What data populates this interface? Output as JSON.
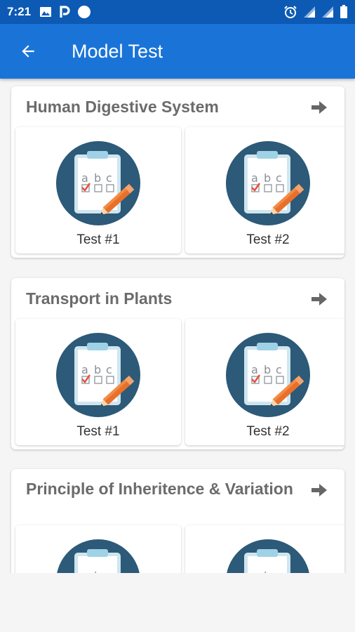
{
  "status_bar": {
    "time": "7:21",
    "left_icons": [
      "image-icon",
      "p-app-icon",
      "circle-app-icon"
    ],
    "right_icons": [
      "alarm-icon",
      "signal-icon",
      "signal-icon",
      "battery-icon"
    ]
  },
  "app_bar": {
    "title": "Model Test",
    "back_icon": "arrow-back-icon"
  },
  "colors": {
    "status_bar": "#0d5ab4",
    "app_bar": "#1a74d8",
    "section_title": "#6b6b6b",
    "icon_circle": "#2c5a78",
    "pencil": "#e8702a"
  },
  "sections": [
    {
      "title": "Human Digestive System",
      "tests": [
        {
          "label": "Test #1",
          "icon": "quiz-clipboard-icon"
        },
        {
          "label": "Test #2",
          "icon": "quiz-clipboard-icon"
        }
      ]
    },
    {
      "title": "Transport in Plants",
      "tests": [
        {
          "label": "Test #1",
          "icon": "quiz-clipboard-icon"
        },
        {
          "label": "Test #2",
          "icon": "quiz-clipboard-icon"
        }
      ]
    },
    {
      "title": "Principle of Inheritence & Variation",
      "tests": [
        {
          "label": "",
          "icon": "quiz-clipboard-icon"
        },
        {
          "label": "",
          "icon": "quiz-clipboard-icon"
        }
      ]
    }
  ]
}
